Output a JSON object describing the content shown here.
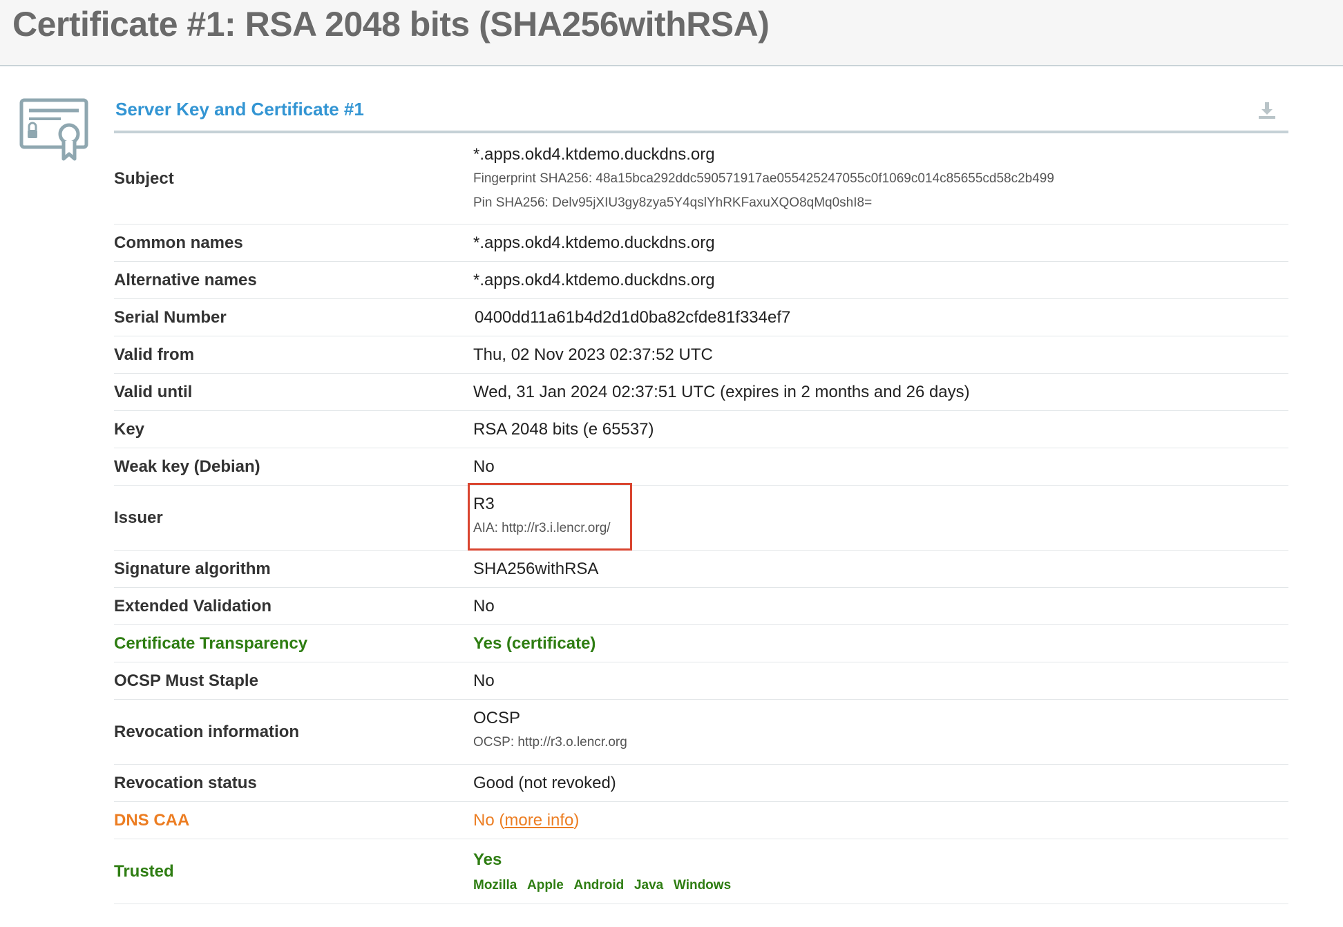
{
  "page": {
    "title": "Certificate #1: RSA 2048 bits (SHA256withRSA)"
  },
  "section": {
    "title": "Server Key and Certificate #1",
    "icons": {
      "certificate": "certificate-icon",
      "download": "download-icon"
    }
  },
  "colors": {
    "title_blue": "#3395d3",
    "good_green": "#2e7d12",
    "warn_orange": "#ec7d22",
    "highlight_red": "#d9442f"
  },
  "rows": {
    "subject": {
      "label": "Subject",
      "value": "*.apps.okd4.ktdemo.duckdns.org",
      "fingerprint": "Fingerprint SHA256: 48a15bca292ddc590571917ae055425247055c0f1069c014c85655cd58c2b499",
      "pin": "Pin SHA256: Delv95jXIU3gy8zya5Y4qslYhRKFaxuXQO8qMq0shI8="
    },
    "common_names": {
      "label": "Common names",
      "value": "*.apps.okd4.ktdemo.duckdns.org"
    },
    "alternative_names": {
      "label": "Alternative names",
      "value": "*.apps.okd4.ktdemo.duckdns.org"
    },
    "serial_number": {
      "label": "Serial Number",
      "value": "0400dd11a61b4d2d1d0ba82cfde81f334ef7"
    },
    "valid_from": {
      "label": "Valid from",
      "value": "Thu, 02 Nov 2023 02:37:52 UTC"
    },
    "valid_until": {
      "label": "Valid until",
      "value": "Wed, 31 Jan 2024 02:37:51 UTC (expires in 2 months and 26 days)"
    },
    "key": {
      "label": "Key",
      "value": "RSA 2048 bits (e 65537)"
    },
    "weak_key": {
      "label": "Weak key (Debian)",
      "value": "No"
    },
    "issuer": {
      "label": "Issuer",
      "value": "R3",
      "aia": "AIA: http://r3.i.lencr.org/"
    },
    "signature_algorithm": {
      "label": "Signature algorithm",
      "value": "SHA256withRSA"
    },
    "extended_validation": {
      "label": "Extended Validation",
      "value": "No"
    },
    "certificate_transparency": {
      "label": "Certificate Transparency",
      "value": "Yes (certificate)"
    },
    "ocsp_must_staple": {
      "label": "OCSP Must Staple",
      "value": "No"
    },
    "revocation_information": {
      "label": "Revocation information",
      "value": "OCSP",
      "ocsp": "OCSP: http://r3.o.lencr.org"
    },
    "revocation_status": {
      "label": "Revocation status",
      "value": "Good (not revoked)"
    },
    "dns_caa": {
      "label": "DNS CAA",
      "value": "No",
      "link_open": "(",
      "link": "more info",
      "link_close": ")"
    },
    "trusted": {
      "label": "Trusted",
      "value": "Yes",
      "stores": [
        "Mozilla",
        "Apple",
        "Android",
        "Java",
        "Windows"
      ]
    }
  }
}
